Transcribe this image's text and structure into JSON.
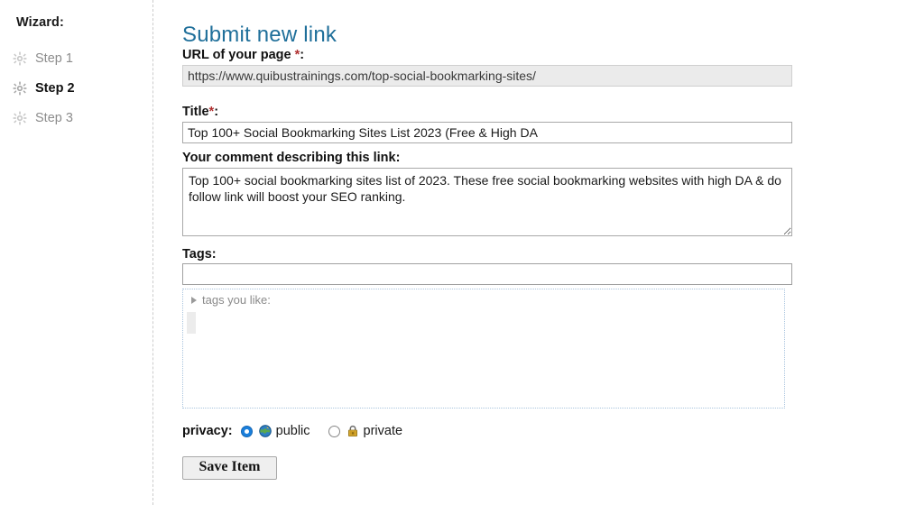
{
  "sidebar": {
    "title": "Wizard:",
    "steps": [
      {
        "label": "Step 1",
        "icon": "gear-icon",
        "current": false
      },
      {
        "label": "Step 2",
        "icon": "gear-icon",
        "current": true
      },
      {
        "label": "Step 3",
        "icon": "gear-icon",
        "current": false
      }
    ]
  },
  "main": {
    "heading": "Submit new link",
    "url_field": {
      "label": "URL of your page",
      "required_marker": "*",
      "colon": ":",
      "value": "https://www.quibustrainings.com/top-social-bookmarking-sites/",
      "placeholder": "",
      "readonly": true
    },
    "title_field": {
      "label": "Title",
      "required_marker": "*",
      "colon": ":",
      "value": "Top 100+ Social Bookmarking Sites List 2023 (Free & High DA",
      "placeholder": ""
    },
    "comment_field": {
      "label": "Your comment describing this link:",
      "value": "Top 100+ social bookmarking sites list of 2023. These free social bookmarking websites with high DA & do follow link will boost your SEO ranking.",
      "placeholder": ""
    },
    "tags_field": {
      "label": "Tags:",
      "value": "",
      "placeholder": "",
      "suggest_label": "tags you like:"
    },
    "privacy": {
      "label": "privacy:",
      "options": [
        {
          "value": "public",
          "label": "public",
          "icon": "globe-icon",
          "selected": true
        },
        {
          "value": "private",
          "label": "private",
          "icon": "lock-icon",
          "selected": false
        }
      ]
    },
    "save_button_label": "Save Item"
  },
  "colors": {
    "heading": "#1f6f9a",
    "required_star": "#b03030",
    "radio_selected": "#1a7fdc",
    "step_inactive_text": "#8c8c8c",
    "step_active_text": "#111111",
    "readonly_field_bg": "#ebebeb",
    "suggest_border": "#a9c4de",
    "button_bg": "#efefef"
  }
}
